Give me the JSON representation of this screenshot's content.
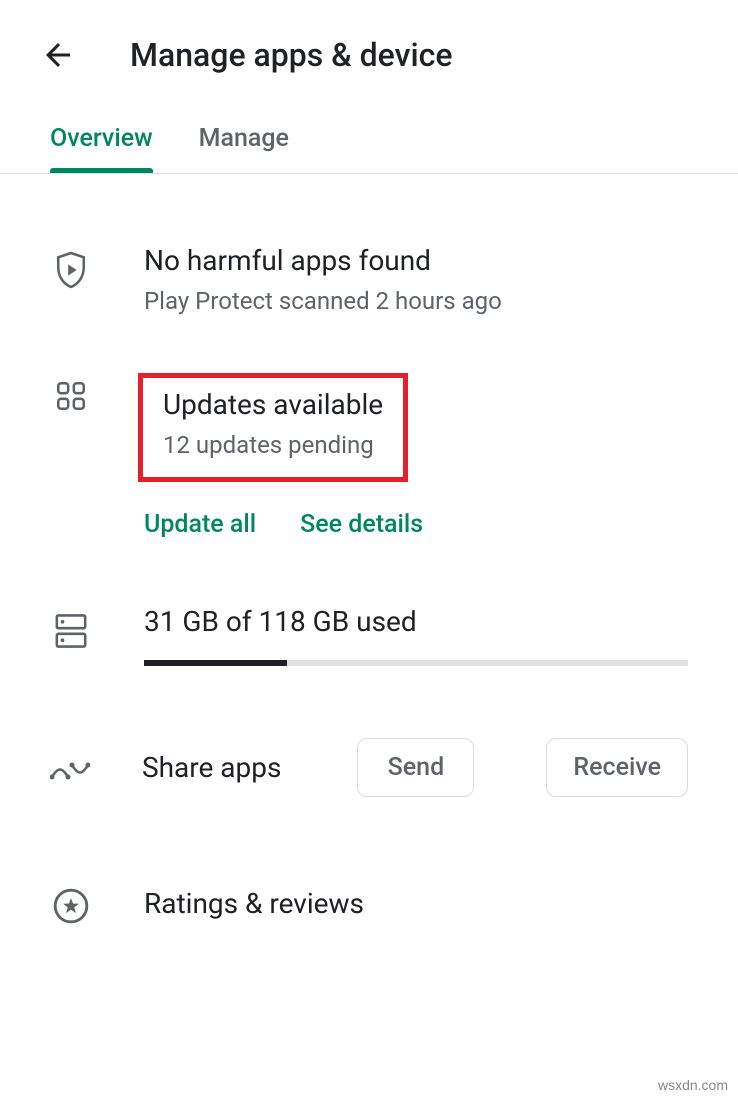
{
  "header": {
    "title": "Manage apps & device"
  },
  "tabs": {
    "overview": "Overview",
    "manage": "Manage"
  },
  "protect": {
    "title": "No harmful apps found",
    "subtitle": "Play Protect scanned 2 hours ago"
  },
  "updates": {
    "title": "Updates available",
    "subtitle": "12 updates pending",
    "update_all": "Update all",
    "see_details": "See details"
  },
  "storage": {
    "title": "31 GB of 118 GB used"
  },
  "share": {
    "title": "Share apps",
    "send": "Send",
    "receive": "Receive"
  },
  "ratings": {
    "title": "Ratings & reviews"
  },
  "watermark": "wsxdn.com"
}
